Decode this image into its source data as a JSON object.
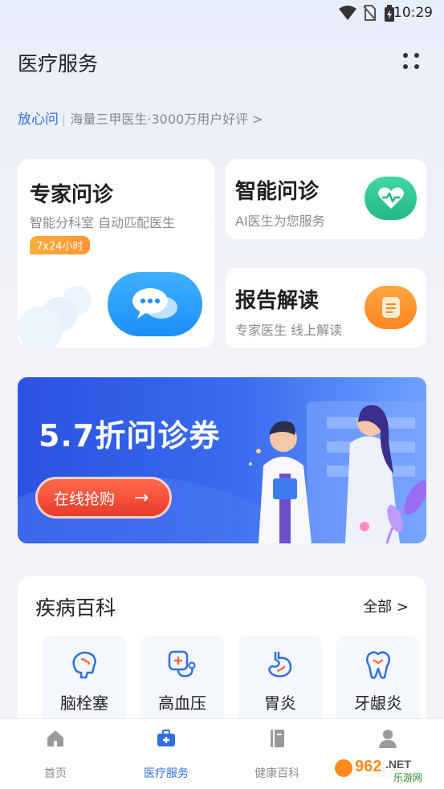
{
  "status_bar": {
    "time": "10:29"
  },
  "header": {
    "title": "医疗服务"
  },
  "slogan": {
    "brand": "放心问",
    "separator": "|",
    "desc": "海量三甲医生·3000万用户好评 >"
  },
  "cards": {
    "expert": {
      "title": "专家问诊",
      "subtitle": "智能分科室 自动匹配医生",
      "badge": "7x24小时"
    },
    "smart": {
      "title": "智能问诊",
      "subtitle": "AI医生为您服务"
    },
    "report": {
      "title": "报告解读",
      "subtitle": "专家医生 线上解读"
    }
  },
  "banner": {
    "title": "5.7折问诊券",
    "button": "在线抢购",
    "arrow": "→"
  },
  "disease": {
    "title": "疾病百科",
    "all_label": "全部 >",
    "items": [
      {
        "label": "脑栓塞",
        "icon": "brain-icon"
      },
      {
        "label": "高血压",
        "icon": "stethoscope-icon"
      },
      {
        "label": "胃炎",
        "icon": "stomach-icon"
      },
      {
        "label": "牙龈炎",
        "icon": "tooth-icon"
      }
    ]
  },
  "tabs": [
    {
      "label": "首页",
      "icon": "home-icon",
      "active": false
    },
    {
      "label": "医疗服务",
      "icon": "medical-kit-icon",
      "active": true
    },
    {
      "label": "健康百科",
      "icon": "book-icon",
      "active": false
    },
    {
      "label": "我的",
      "icon": "user-icon",
      "active": false
    }
  ],
  "watermark": {
    "text": "962.NET",
    "sub": "乐游网"
  },
  "colors": {
    "accent": "#2f6fe3",
    "green": "#2fc89a",
    "orange": "#ff8f2e",
    "banner": "#3a6cf0"
  }
}
